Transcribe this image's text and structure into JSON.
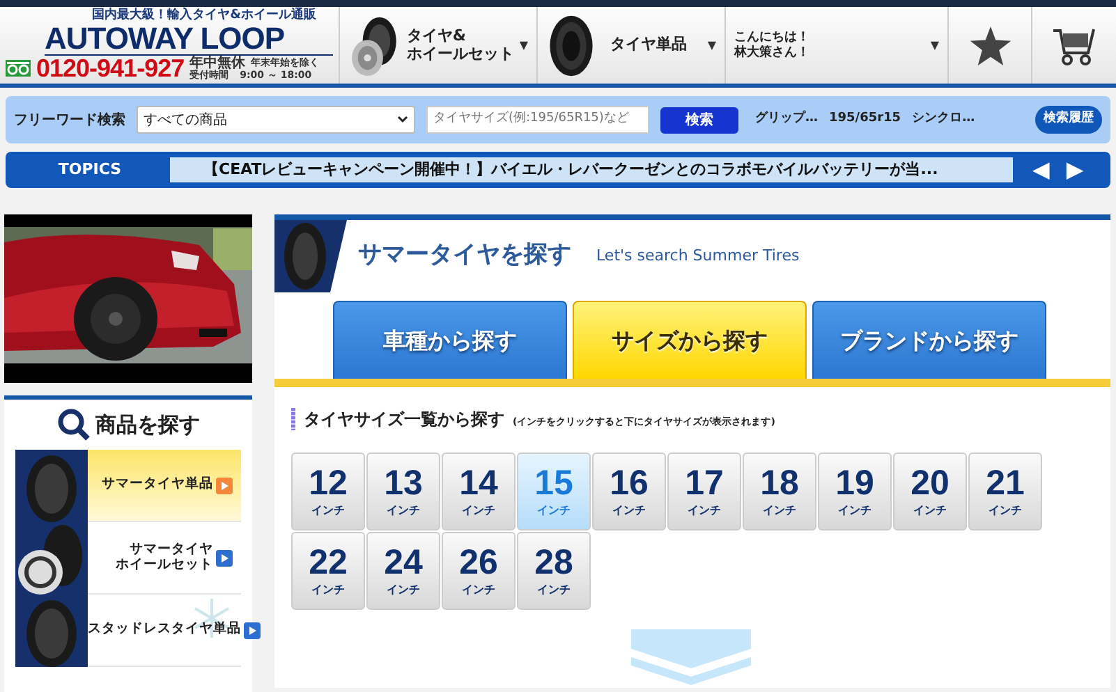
{
  "header": {
    "tagline": "国内最大級！輸入タイヤ&ホイール通販",
    "brand": "AUTOWAY LOOP",
    "phone": "0120-941-927",
    "open_days": "年中無休",
    "open_note": "年末年始を除く",
    "hours_label": "受付時間",
    "hours": "9:00 ～ 18:00"
  },
  "nav": [
    {
      "kind": "tire-wheel",
      "lines": [
        "タイヤ&",
        "ホイールセット"
      ],
      "caret": "▼"
    },
    {
      "kind": "tire",
      "lines": [
        "タイヤ単品"
      ],
      "caret": "▼"
    },
    {
      "kind": "greeting",
      "lines": [
        "こんにちは！",
        "林大策さん！"
      ],
      "caret": "▼"
    },
    {
      "kind": "star"
    },
    {
      "kind": "cart"
    }
  ],
  "search": {
    "label": "フリーワード検索",
    "category": "すべての商品",
    "placeholder": "タイヤサイズ(例:195/65R15)など",
    "button": "検索",
    "keywords": [
      "グリップ…",
      "195/65r15",
      "シンクロ…"
    ],
    "history": "検索履歴"
  },
  "topics": {
    "label": "TOPICS",
    "text": "【CEATレビューキャンペーン開催中！】バイエル・レバークーゼンとのコラボモバイルバッテリーが当...",
    "prev": "◀",
    "next": "▶"
  },
  "sidebar": {
    "title": "商品を探す",
    "items": [
      {
        "lines": [
          "サマータイヤ単品"
        ],
        "kind": "tire",
        "selected": true
      },
      {
        "lines": [
          "サマータイヤ",
          "ホイールセット"
        ],
        "kind": "wheel",
        "selected": false
      },
      {
        "lines": [
          "スタッドレスタイヤ単品"
        ],
        "kind": "snow",
        "selected": false
      }
    ]
  },
  "main": {
    "title": "サマータイヤを探す",
    "subtitle": "Let's search Summer Tires",
    "tabs": [
      {
        "label": "車種から探す",
        "selected": false
      },
      {
        "label": "サイズから探す",
        "selected": true
      },
      {
        "label": "ブランドから探す",
        "selected": false
      }
    ],
    "section_title": "タイヤサイズ一覧から探す",
    "section_note": "(インチをクリックすると下にタイヤサイズが表示されます)",
    "sizes": [
      {
        "number": "12",
        "unit": "インチ",
        "selected": false
      },
      {
        "number": "13",
        "unit": "インチ",
        "selected": false
      },
      {
        "number": "14",
        "unit": "インチ",
        "selected": false
      },
      {
        "number": "15",
        "unit": "インチ",
        "selected": true
      },
      {
        "number": "16",
        "unit": "インチ",
        "selected": false
      },
      {
        "number": "17",
        "unit": "インチ",
        "selected": false
      },
      {
        "number": "18",
        "unit": "インチ",
        "selected": false
      },
      {
        "number": "19",
        "unit": "インチ",
        "selected": false
      },
      {
        "number": "20",
        "unit": "インチ",
        "selected": false
      },
      {
        "number": "21",
        "unit": "インチ",
        "selected": false
      },
      {
        "number": "22",
        "unit": "インチ",
        "selected": false
      },
      {
        "number": "24",
        "unit": "インチ",
        "selected": false
      },
      {
        "number": "26",
        "unit": "インチ",
        "selected": false
      },
      {
        "number": "28",
        "unit": "インチ",
        "selected": false
      }
    ]
  }
}
